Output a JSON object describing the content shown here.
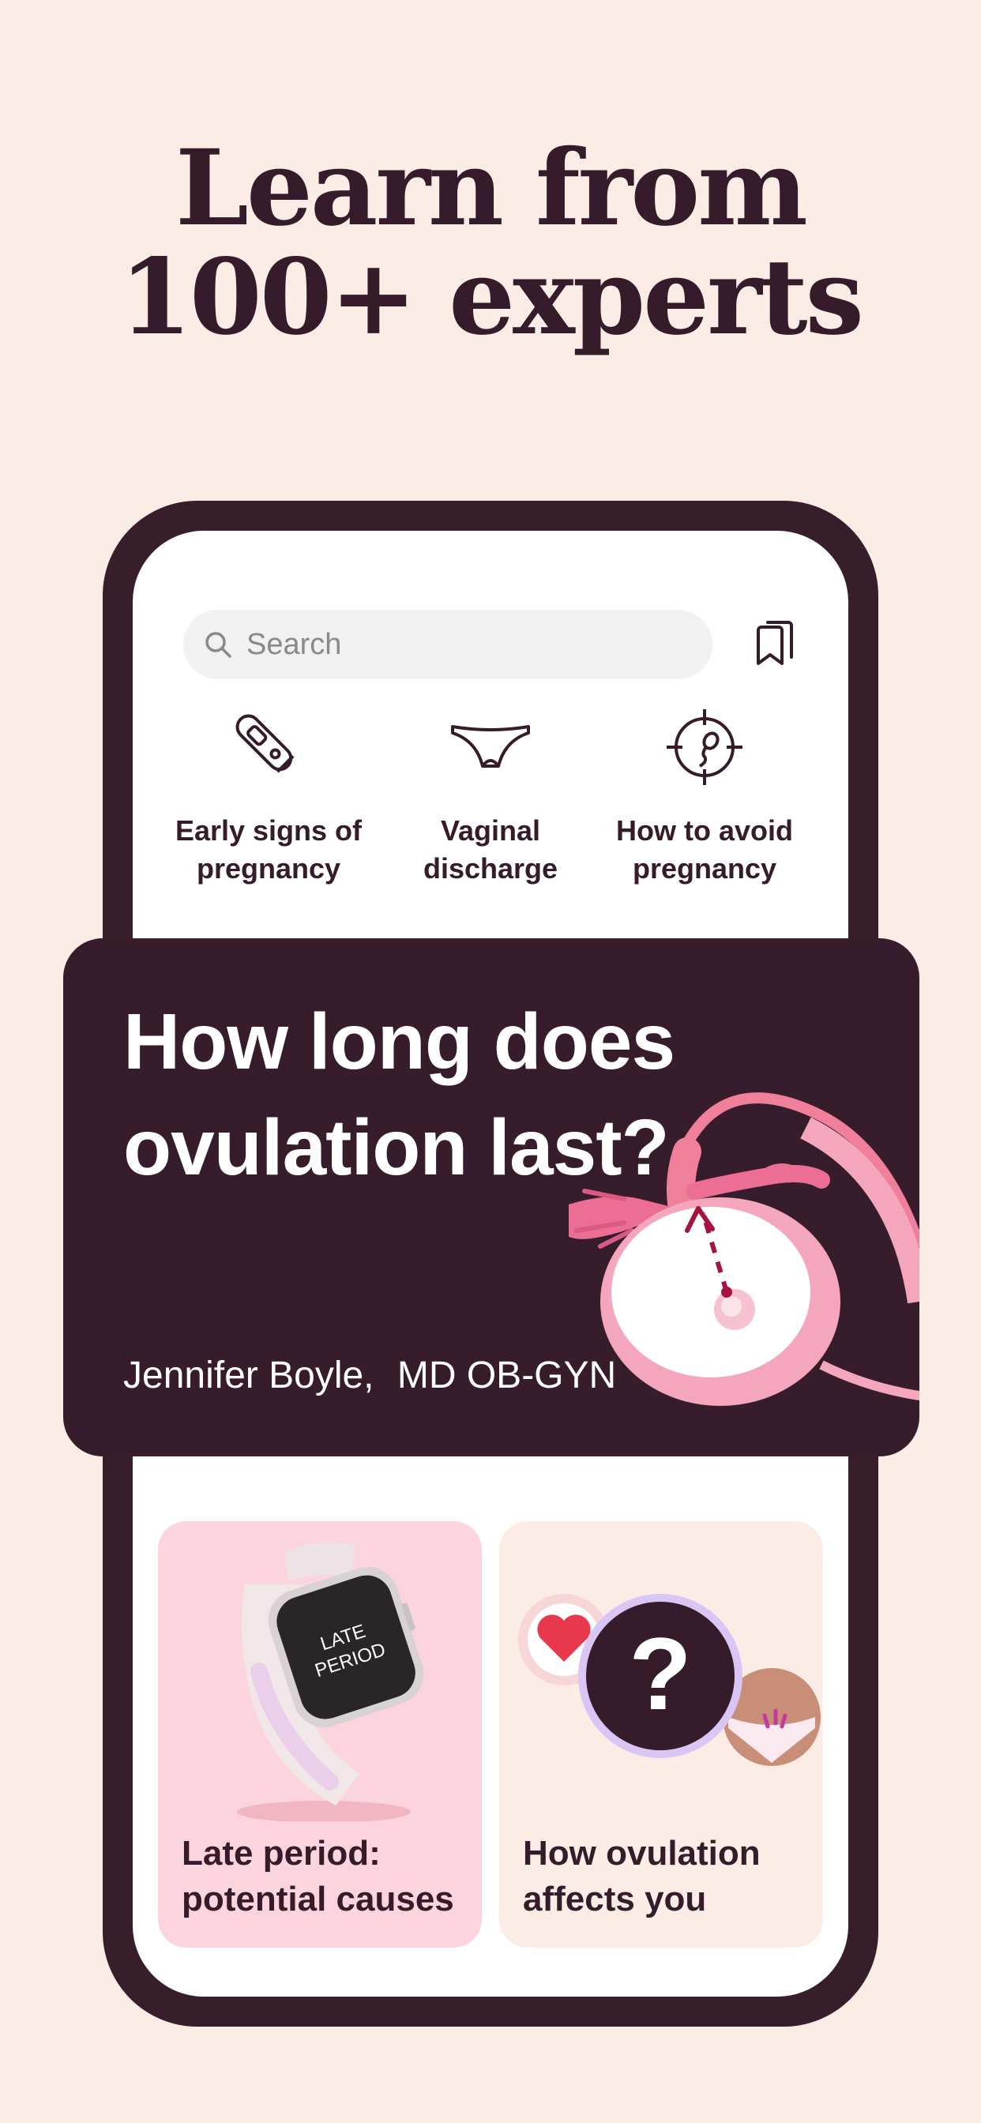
{
  "headline": {
    "line1": "Learn from",
    "line2": "100+ experts"
  },
  "search": {
    "placeholder": "Search",
    "icon": "search-icon"
  },
  "bookmark": {
    "icon": "bookmark-icon"
  },
  "topics": [
    {
      "label": "Early signs of pregnancy",
      "line1": "Early signs of",
      "line2": "pregnancy",
      "icon": "pregnancy-test-icon"
    },
    {
      "label": "Vaginal discharge",
      "line1": "Vaginal",
      "line2": "discharge",
      "icon": "underwear-icon"
    },
    {
      "label": "How to avoid pregnancy",
      "line1": "How to avoid",
      "line2": "pregnancy",
      "icon": "target-sperm-icon"
    }
  ],
  "feature": {
    "title": "How long does ovulation last?",
    "author_name": "Jennifer Boyle,",
    "author_credentials": "MD OB-GYN",
    "illustration": "ovary-illustration"
  },
  "cards": [
    {
      "title_line1": "Late period:",
      "title_line2": "potential causes",
      "watch_text_line1": "LATE",
      "watch_text_line2": "PERIOD",
      "illustration": "smartwatch-illustration"
    },
    {
      "title_line1": "How ovulation",
      "title_line2": "affects you",
      "question_mark": "?",
      "illustration": "question-mark-illustration"
    }
  ],
  "colors": {
    "background": "#FBEDE5",
    "dark": "#371C2B",
    "pink_card": "#FCD4DD",
    "accent_pink": "#F07F9C",
    "heart_red": "#E7384D",
    "lavender": "#C9B3F0"
  }
}
